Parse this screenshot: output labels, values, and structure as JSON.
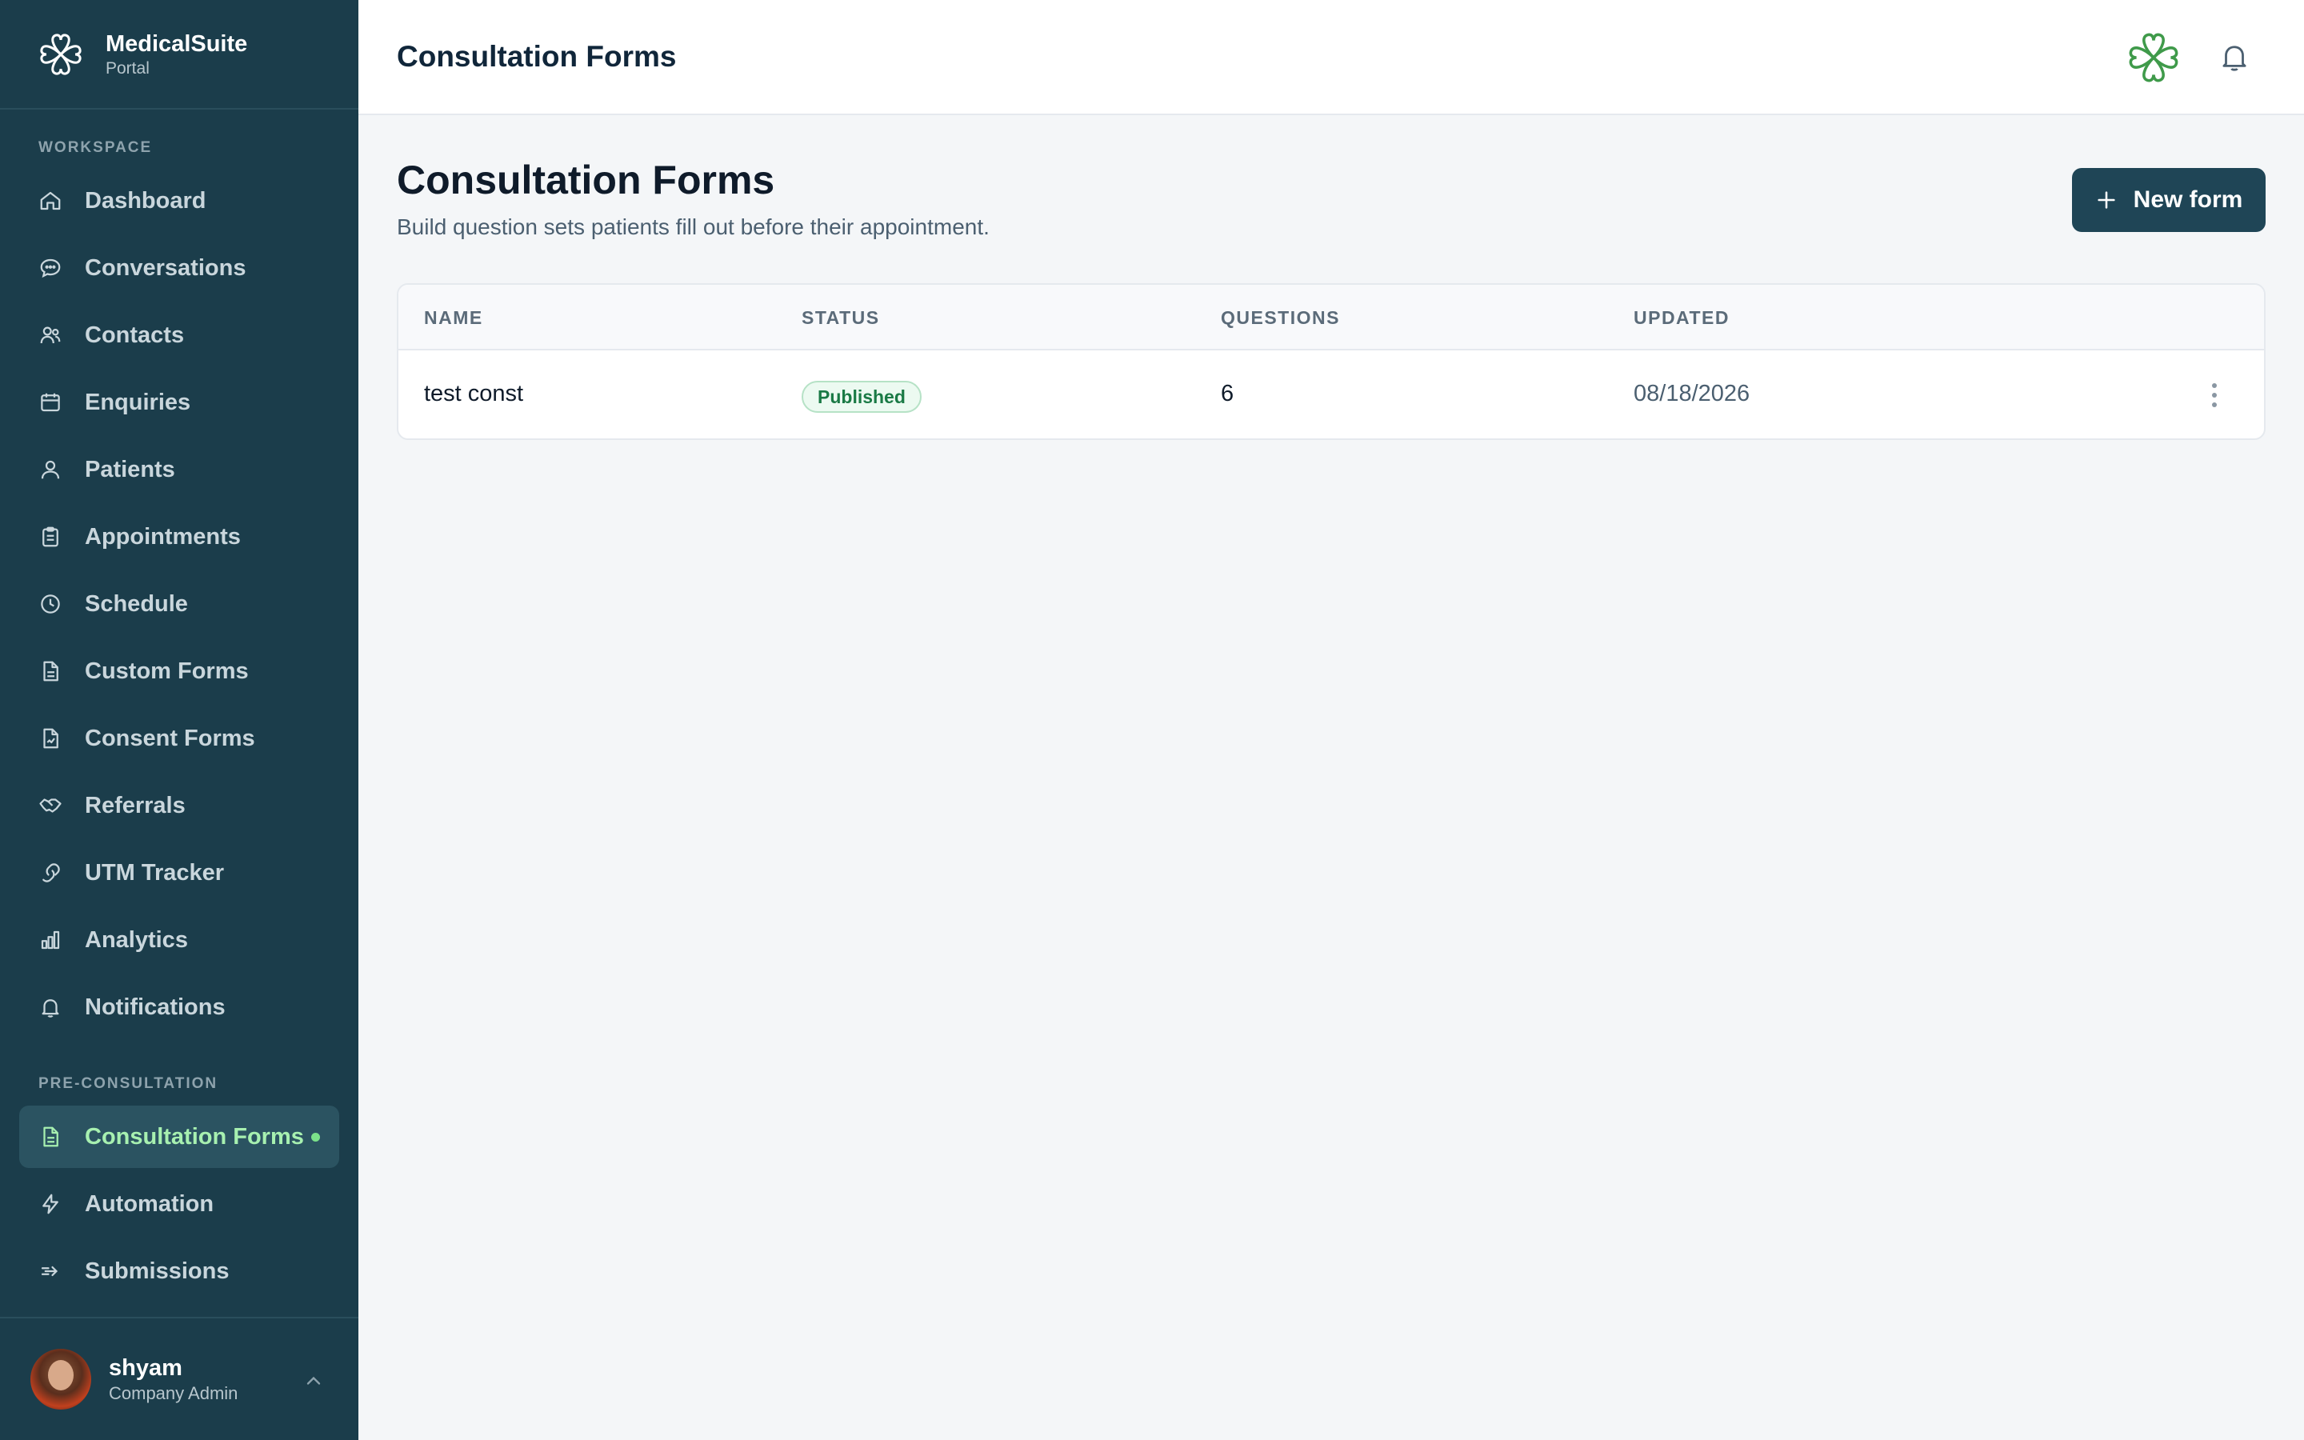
{
  "brand": {
    "name": "MedicalSuite",
    "subtitle": "Portal"
  },
  "sidebar": {
    "workspace_label": "WORKSPACE",
    "workspace_items": [
      {
        "label": "Dashboard",
        "icon": "home-icon"
      },
      {
        "label": "Conversations",
        "icon": "chat-bubble-icon"
      },
      {
        "label": "Contacts",
        "icon": "users-icon"
      },
      {
        "label": "Enquiries",
        "icon": "calendar-icon"
      },
      {
        "label": "Patients",
        "icon": "user-icon"
      },
      {
        "label": "Appointments",
        "icon": "clipboard-icon"
      },
      {
        "label": "Schedule",
        "icon": "clock-icon"
      },
      {
        "label": "Custom Forms",
        "icon": "document-icon"
      },
      {
        "label": "Consent Forms",
        "icon": "signed-document-icon"
      },
      {
        "label": "Referrals",
        "icon": "handshake-icon"
      },
      {
        "label": "UTM Tracker",
        "icon": "link-icon"
      },
      {
        "label": "Analytics",
        "icon": "bar-chart-icon"
      },
      {
        "label": "Notifications",
        "icon": "bell-icon"
      }
    ],
    "preconsult_label": "PRE-CONSULTATION",
    "preconsult_items": [
      {
        "label": "Consultation Forms",
        "icon": "document-icon",
        "active": true
      },
      {
        "label": "Automation",
        "icon": "lightning-icon"
      },
      {
        "label": "Submissions",
        "icon": "send-icon"
      }
    ]
  },
  "user": {
    "name": "shyam",
    "role": "Company Admin"
  },
  "header": {
    "title": "Consultation Forms"
  },
  "main": {
    "title": "Consultation Forms",
    "subtitle": "Build question sets patients fill out before their appointment.",
    "new_button": "New form"
  },
  "table": {
    "columns": [
      "NAME",
      "STATUS",
      "QUESTIONS",
      "UPDATED"
    ],
    "rows": [
      {
        "name": "test const",
        "status": "Published",
        "questions": "6",
        "updated": "08/18/2026"
      }
    ]
  },
  "colors": {
    "sidebar_bg": "#1b3d4b",
    "active_bg": "#2b5361",
    "active_text": "#a7f0b0",
    "primary_button": "#1f4556",
    "status_published": "#1a7a45",
    "logo_green": "#3f9a4a"
  }
}
